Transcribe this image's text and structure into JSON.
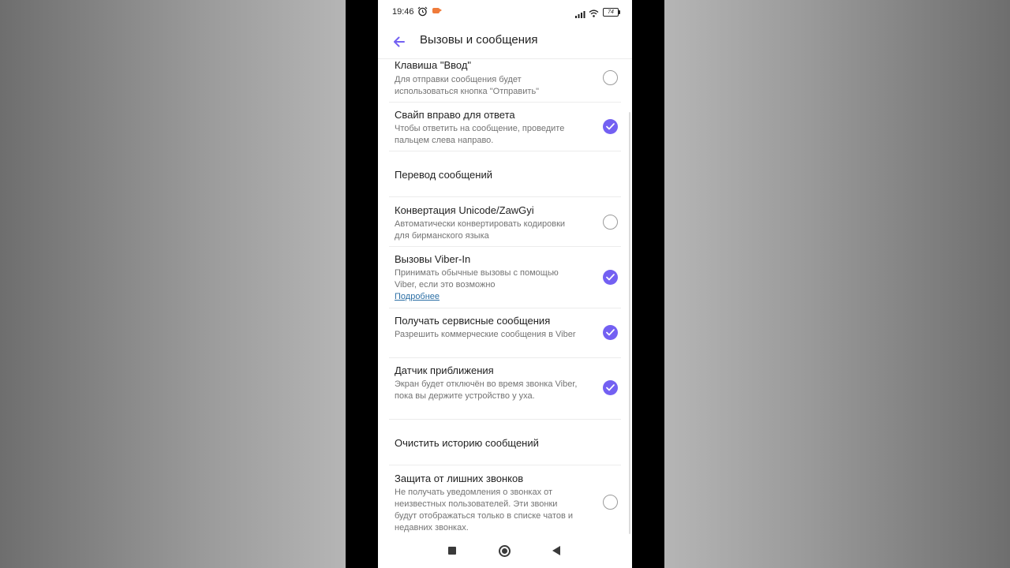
{
  "status_bar": {
    "time": "19:46",
    "battery": "74",
    "icons": [
      "alarm-icon",
      "screen-record-icon",
      "signal-icon",
      "wifi-icon",
      "battery-icon"
    ]
  },
  "app_bar": {
    "title": "Вызовы и сообщения",
    "back_icon": "arrow-left-icon"
  },
  "colors": {
    "accent": "#7360f2",
    "link": "#2c6fa5",
    "text_primary": "#1f1f1f",
    "text_secondary": "#737373"
  },
  "settings": [
    {
      "title": "Клавиша \"Ввод\"",
      "subtitle": "Для отправки сообщения будет использоваться кнопка \"Отправить\"",
      "checked": false
    },
    {
      "title": "Свайп вправо для ответа",
      "subtitle": "Чтобы ответить на сообщение, проведите пальцем слева направо.",
      "checked": true
    },
    {
      "title": "Перевод сообщений"
    },
    {
      "title": "Конвертация Unicode/ZawGyi",
      "subtitle": "Автоматически конвертировать кодировки для бирманского языка",
      "checked": false
    },
    {
      "title": "Вызовы Viber-In",
      "subtitle": "Принимать обычные вызовы с помощью Viber, если это возможно",
      "link": "Подробнее",
      "checked": true
    },
    {
      "title": "Получать сервисные сообщения",
      "subtitle": "Разрешить коммерческие сообщения в Viber",
      "checked": true
    },
    {
      "title": "Датчик приближения",
      "subtitle": "Экран будет отключён во время звонка Viber, пока вы держите устройство у уха.",
      "checked": true
    },
    {
      "title": "Очистить историю сообщений"
    },
    {
      "title": "Защита от лишних звонков",
      "subtitle": "Не получать уведомления о звонках от неизвестных пользователей. Эти звонки будут отображаться только в списке чатов и недавних звонках.",
      "checked": false
    }
  ],
  "nav_bar": {
    "buttons": [
      "recents-button",
      "home-button",
      "back-button"
    ]
  }
}
